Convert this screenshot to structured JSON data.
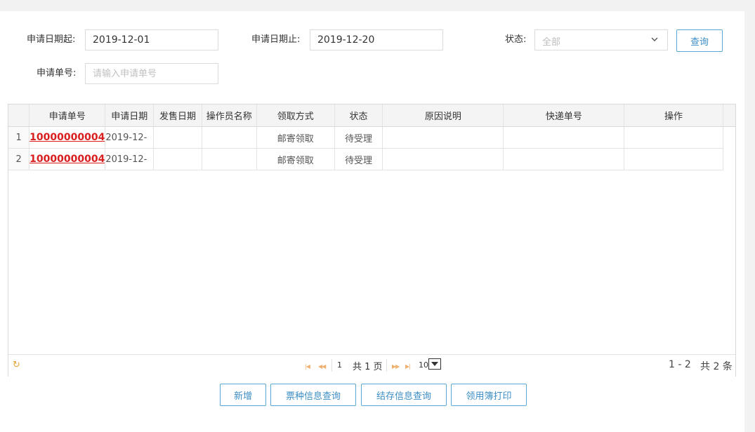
{
  "filters": {
    "start_label": "申请日期起:",
    "start_value": "2019-12-01",
    "end_label": "申请日期止:",
    "end_value": "2019-12-20",
    "status_label": "状态:",
    "status_value": "全部",
    "query_button": "查询",
    "order_label": "申请单号:",
    "order_placeholder": "请输入申请单号"
  },
  "table": {
    "columns": [
      "申请单号",
      "申请日期",
      "发售日期",
      "操作员名称",
      "领取方式",
      "状态",
      "原因说明",
      "快递单号",
      "操作"
    ],
    "rows": [
      {
        "index": "1",
        "order_no": "10000000004",
        "apply_date": "2019-12-",
        "sale_date": "",
        "operator": "",
        "method": "邮寄领取",
        "status": "待受理",
        "reason": "",
        "express_no": "",
        "action": ""
      },
      {
        "index": "2",
        "order_no": "10000000004",
        "apply_date": "2019-12-",
        "sale_date": "",
        "operator": "",
        "method": "邮寄领取",
        "status": "待受理",
        "reason": "",
        "express_no": "",
        "action": ""
      }
    ]
  },
  "pager": {
    "page_value": "1",
    "page_total_text": "共 1 页",
    "page_size": "10",
    "range_text": "1 - 2",
    "count_text": "共 2 条"
  },
  "actions": {
    "add": "新增",
    "ticket_query": "票种信息查询",
    "stock_query": "结存信息查询",
    "print_book": "领用簿打印"
  },
  "colors": {
    "accent": "#3c8dc4",
    "link": "#d81e1e",
    "pager_icon": "#f0b070"
  }
}
